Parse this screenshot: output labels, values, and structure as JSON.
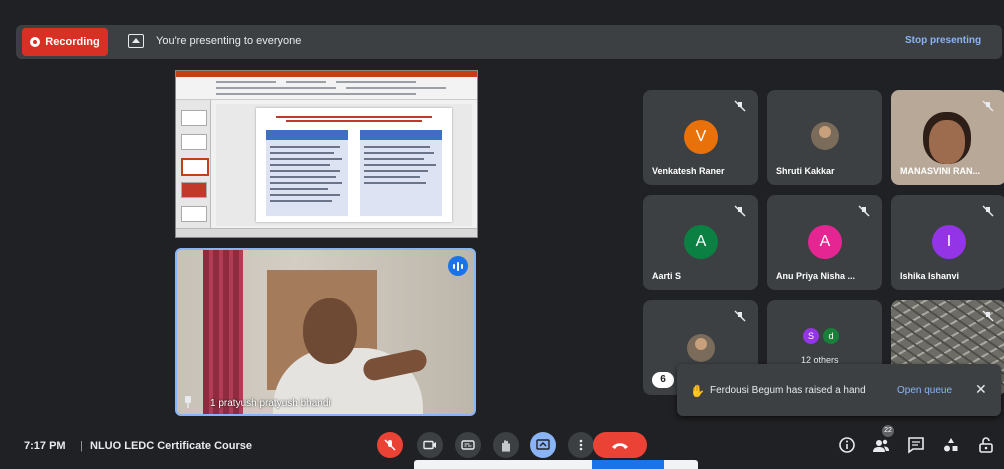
{
  "topbar": {
    "recording_label": "Recording",
    "presenting_text": "You're presenting to everyone",
    "stop_presenting_label": "Stop presenting"
  },
  "presenter": {
    "name": "1 pratyush pratyush bhandi",
    "speaking": true
  },
  "participants": [
    {
      "name": "Venkatesh Raner",
      "avatar": "V",
      "avatar_color": "#e8710a",
      "muted": true
    },
    {
      "name": "Shruti Kakkar",
      "avatar": "photo",
      "muted": false
    },
    {
      "name": "MANASVINI RAN...",
      "avatar": "camera",
      "muted": true
    },
    {
      "name": "Aarti S",
      "avatar": "A",
      "avatar_color": "#0b8043",
      "muted": true
    },
    {
      "name": "Anu Priya Nisha ...",
      "avatar": "A",
      "avatar_color": "#e52592",
      "muted": true
    },
    {
      "name": "Ishika Ishanvi",
      "avatar": "I",
      "avatar_color": "#9334e6",
      "muted": true
    }
  ],
  "others_tile": {
    "label": "12 others",
    "avatars": [
      {
        "letter": "S",
        "color": "#9334e6"
      },
      {
        "letter": "d",
        "color": "#188038"
      }
    ]
  },
  "hidden_count": "6",
  "toast": {
    "message": "Ferdousi Begum has raised a hand",
    "action_label": "Open queue"
  },
  "bottombar": {
    "time": "7:17 PM",
    "separator": "|",
    "meeting_title": "NLUO LEDC Certificate Course",
    "people_count": "22"
  },
  "icons": {
    "mic": "mic-off-icon",
    "camera": "camera-icon",
    "captions": "closed-captions-icon",
    "hand": "raise-hand-icon",
    "present": "present-screen-icon",
    "more": "more-options-icon",
    "end": "end-call-icon",
    "info": "info-icon",
    "people": "people-icon",
    "chat": "chat-icon",
    "activities": "activities-icon",
    "host": "host-controls-icon"
  },
  "colors": {
    "background": "#202124",
    "surface": "#3c4043",
    "danger": "#ea4335",
    "accent": "#8ab4f8"
  }
}
